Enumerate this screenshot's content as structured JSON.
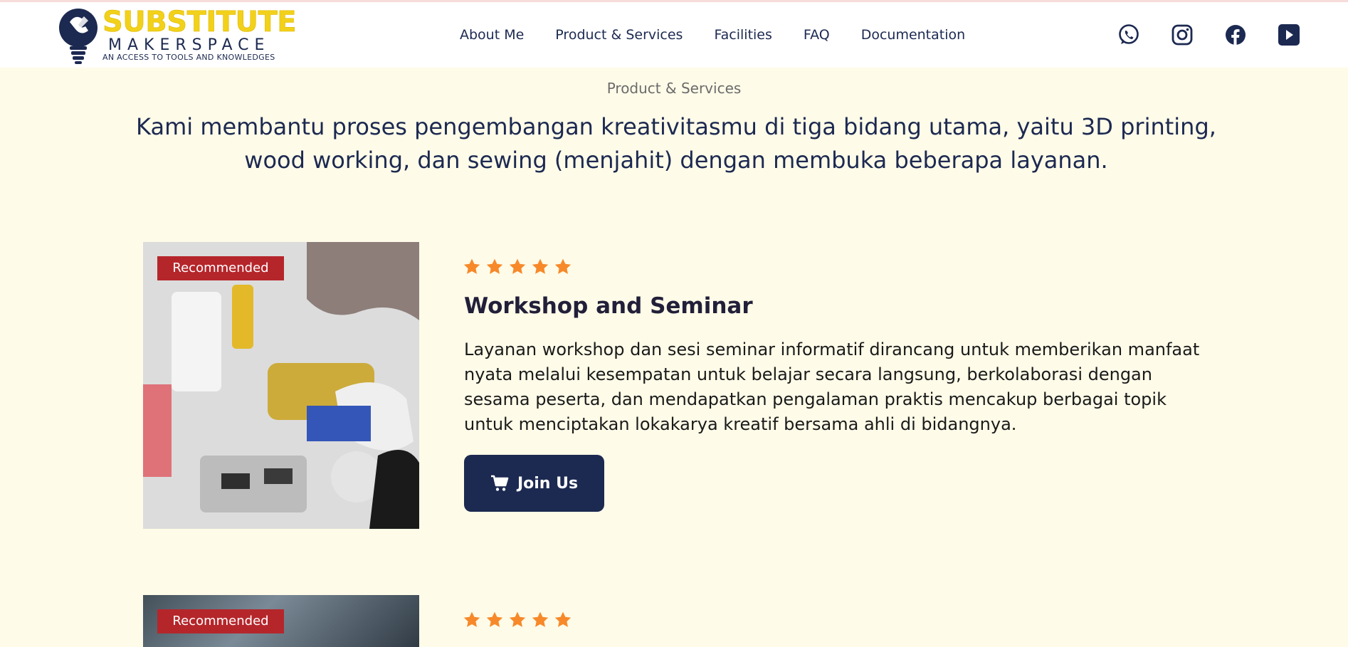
{
  "header": {
    "logo": {
      "title": "SUBSTITUTE",
      "subtitle": "MAKERSPACE",
      "tagline": "AN ACCESS TO TOOLS AND KNOWLEDGES"
    },
    "nav": [
      "About Me",
      "Product & Services",
      "Facilities",
      "FAQ",
      "Documentation"
    ],
    "social_icons": [
      "whatsapp-icon",
      "instagram-icon",
      "facebook-icon",
      "youtube-icon"
    ]
  },
  "main": {
    "section_label": "Product & Services",
    "headline": "Kami membantu proses pengembangan kreativitasmu di tiga bidang utama, yaitu 3D printing, wood working, dan sewing (menjahit) dengan membuka beberapa layanan.",
    "cards": [
      {
        "badge": "Recommended",
        "rating": 5,
        "title": "Workshop and Seminar",
        "description": "Layanan workshop dan sesi seminar informatif dirancang untuk memberikan manfaat nyata melalui kesempatan untuk belajar secara langsung, berkolaborasi dengan sesama peserta, dan mendapatkan pengalaman praktis mencakup berbagai topik untuk menciptakan lokakarya kreatif bersama ahli di bidangnya.",
        "button": "Join Us",
        "button_icon": "cart-icon"
      },
      {
        "badge": "Recommended",
        "rating": 5
      }
    ]
  },
  "colors": {
    "page_background": "#fefbe8",
    "navy": "#1c2951",
    "logo_yellow": "#f2d11a",
    "badge_red": "#b5262b",
    "star_orange": "#f7892a"
  }
}
